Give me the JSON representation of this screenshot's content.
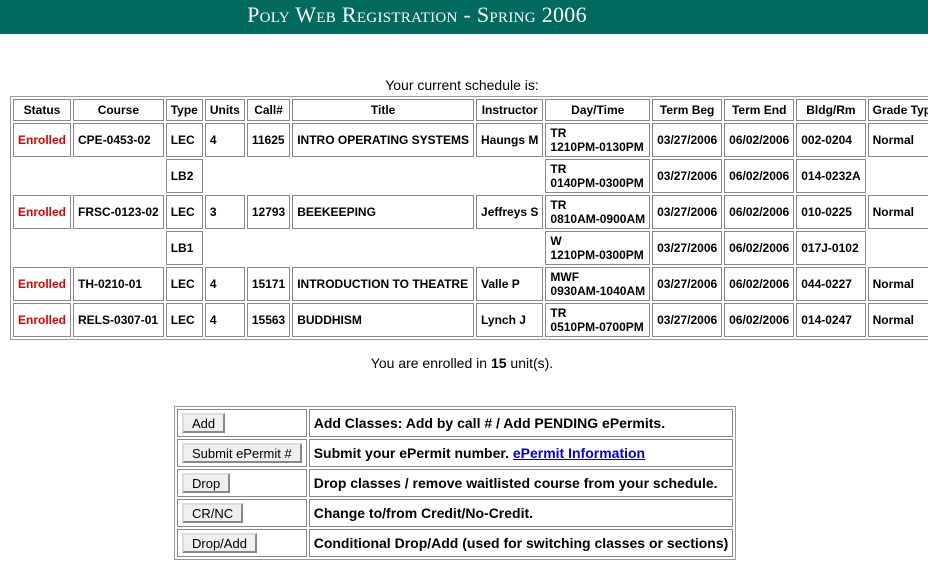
{
  "header": {
    "title": "Poly Web Registration - Spring 2006"
  },
  "schedule": {
    "caption": "Your current schedule is:",
    "columns": [
      "Status",
      "Course",
      "Type",
      "Units",
      "Call#",
      "Title",
      "Instructor",
      "Day/Time",
      "Term Beg",
      "Term End",
      "Bldg/Rm",
      "Grade Type"
    ],
    "rows": [
      {
        "status": "Enrolled",
        "course": "CPE-0453-02",
        "type": "LEC",
        "units": "4",
        "call": "11625",
        "title": "INTRO OPERATING SYSTEMS",
        "instructor": "Haungs M",
        "days": "TR",
        "time": "1210PM-0130PM",
        "term_beg": "03/27/2006",
        "term_end": "06/02/2006",
        "room": "002-0204",
        "grade": "Normal"
      },
      {
        "status": "",
        "course": "",
        "type": "LB2",
        "units": "",
        "call": "",
        "title": "",
        "instructor": "",
        "days": "TR",
        "time": "0140PM-0300PM",
        "term_beg": "03/27/2006",
        "term_end": "06/02/2006",
        "room": "014-0232A",
        "grade": ""
      },
      {
        "status": "Enrolled",
        "course": "FRSC-0123-02",
        "type": "LEC",
        "units": "3",
        "call": "12793",
        "title": "BEEKEEPING",
        "instructor": "Jeffreys S",
        "days": "TR",
        "time": "0810AM-0900AM",
        "term_beg": "03/27/2006",
        "term_end": "06/02/2006",
        "room": "010-0225",
        "grade": "Normal"
      },
      {
        "status": "",
        "course": "",
        "type": "LB1",
        "units": "",
        "call": "",
        "title": "",
        "instructor": "",
        "days": "W",
        "time": "1210PM-0300PM",
        "term_beg": "03/27/2006",
        "term_end": "06/02/2006",
        "room": "017J-0102",
        "grade": ""
      },
      {
        "status": "Enrolled",
        "course": "TH-0210-01",
        "type": "LEC",
        "units": "4",
        "call": "15171",
        "title": "INTRODUCTION TO THEATRE",
        "instructor": "Valle P",
        "days": "MWF",
        "time": "0930AM-1040AM",
        "term_beg": "03/27/2006",
        "term_end": "06/02/2006",
        "room": "044-0227",
        "grade": "Normal"
      },
      {
        "status": "Enrolled",
        "course": "RELS-0307-01",
        "type": "LEC",
        "units": "4",
        "call": "15563",
        "title": "BUDDHISM",
        "instructor": "Lynch J",
        "days": "TR",
        "time": "0510PM-0700PM",
        "term_beg": "03/27/2006",
        "term_end": "06/02/2006",
        "room": "014-0247",
        "grade": "Normal"
      }
    ]
  },
  "units_summary": {
    "prefix": "You are enrolled in",
    "units": "15",
    "suffix": "unit(s)."
  },
  "actions": [
    {
      "button": "Add",
      "description": "Add Classes: Add by call # / Add PENDING ePermits.",
      "link": ""
    },
    {
      "button": "Submit ePermit #",
      "description": "Submit your ePermit number.",
      "link": "ePermit Information"
    },
    {
      "button": "Drop",
      "description": "Drop classes / remove waitlisted course from your schedule.",
      "link": ""
    },
    {
      "button": "CR/NC",
      "description": "Change to/from Credit/No-Credit.",
      "link": ""
    },
    {
      "button": "Drop/Add",
      "description": "Conditional Drop/Add (used for switching classes or sections)",
      "link": ""
    }
  ],
  "colors": {
    "banner": "#006a5e",
    "status_enrolled": "#e00000",
    "link": "#0000cc"
  }
}
